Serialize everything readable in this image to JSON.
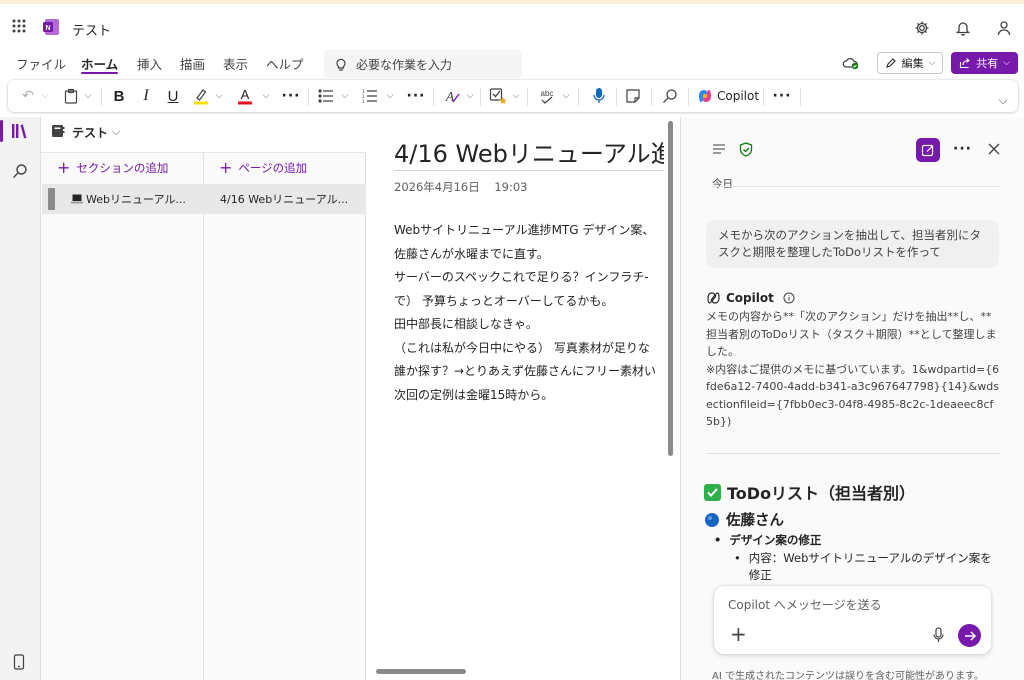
{
  "app": {
    "title": "テスト",
    "accent": "#7719aa"
  },
  "menu": {
    "tabs": [
      "ファイル",
      "ホーム",
      "挿入",
      "描画",
      "表示",
      "ヘルプ"
    ],
    "active": "ホーム"
  },
  "search": {
    "placeholder": "必要な作業を入力"
  },
  "header_actions": {
    "edit_label": "編集",
    "share_label": "共有"
  },
  "ribbon": {
    "copilot_label": "Copilot"
  },
  "notebook": {
    "name": "テスト"
  },
  "sections": {
    "add_label": "セクションの追加",
    "items": [
      {
        "label": "Webリニューアル..."
      }
    ]
  },
  "pages": {
    "add_label": "ページの追加",
    "items": [
      {
        "label": "4/16 Webリニューアル..."
      }
    ]
  },
  "note": {
    "title": "4/16 Webリニューアル進",
    "date": "2026年4月16日",
    "time": "19:03",
    "lines": [
      "Webサイトリニューアル進捗MTG デザイン案、",
      "佐藤さんが水曜までに直す。",
      "サーバーのスペックこれで足りる？インフラチ-",
      "で） 予算ちょっとオーバーしてるかも。",
      "田中部長に相談しなきゃ。",
      "（これは私が今日中にやる） 写真素材が足りな",
      "誰か探す？→とりあえず佐藤さんにフリー素材い",
      "次回の定例は金曜15時から。"
    ]
  },
  "copilot": {
    "today_label": "今日",
    "user_prompt": "メモから次のアクションを抽出して、担当者別にタスクと期限を整理したToDoリストを作って",
    "response_name": "Copilot",
    "response_text": "メモの内容から**「次のアクション」だけを抽出**し、**担当者別のToDoリスト（タスク＋期限）**として整理しました。\n※内容はご提供のメモに基づいています。1&wdpartid={6fde6a12-7400-4add-b341-a3c967647798}{14}&wdsectionfileid={7fbb0ec3-04f8-4985-8c2c-1deaeec8cf5b})",
    "todo_title": "ToDoリスト（担当者別）",
    "assignee": "佐藤さん",
    "bullet_heading": "デザイン案の修正",
    "sub_bullet": "内容：Webサイトリニューアルのデザイン案を修正",
    "input_placeholder": "Copilot へメッセージを送る",
    "disclaimer": "AI で生成されたコンテンツは誤りを含む可能性があります。"
  }
}
